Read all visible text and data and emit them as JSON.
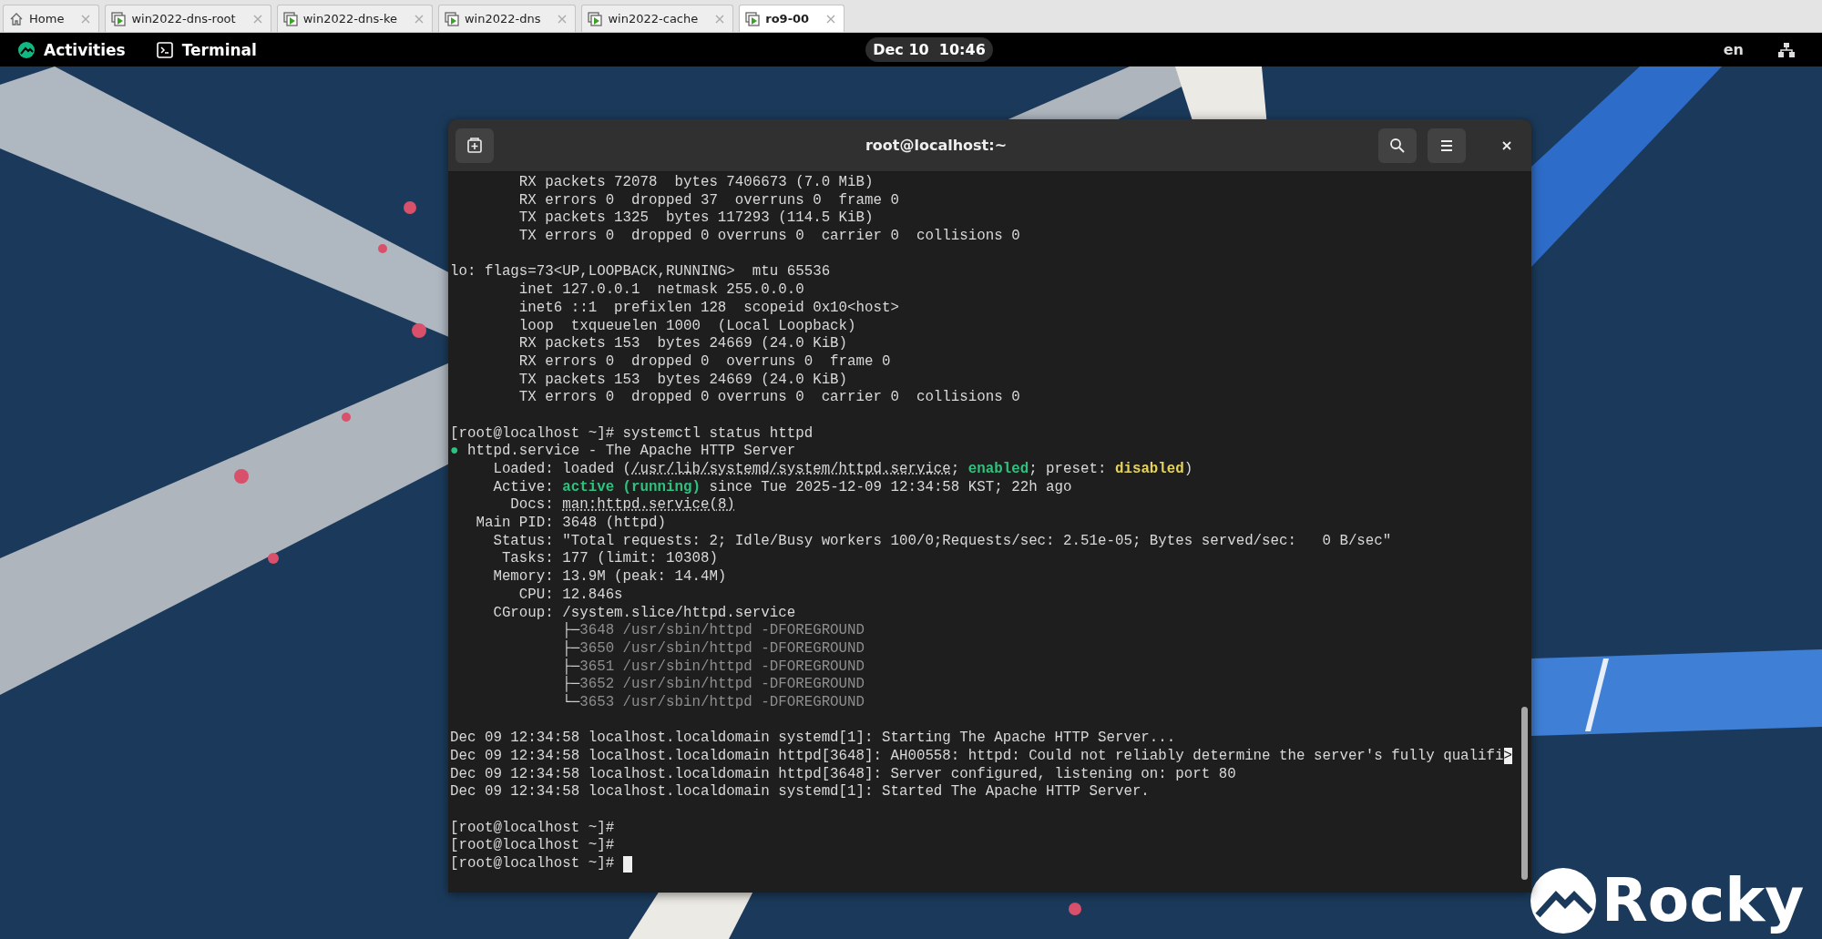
{
  "browser_tabs": [
    {
      "label": "Home",
      "kind": "home",
      "selected": false
    },
    {
      "label": "win2022-dns-root",
      "kind": "vm",
      "selected": false
    },
    {
      "label": "win2022-dns-ke",
      "kind": "vm",
      "selected": false
    },
    {
      "label": "win2022-dns",
      "kind": "vm",
      "selected": false
    },
    {
      "label": "win2022-cache",
      "kind": "vm",
      "selected": false
    },
    {
      "label": "ro9-00",
      "kind": "vm",
      "selected": true
    }
  ],
  "top_bar": {
    "activities": "Activities",
    "app": "Terminal",
    "clock": "Dec 10  10:46",
    "language": "en"
  },
  "terminal": {
    "title": "root@localhost:~",
    "lines": [
      {
        "text": "        RX packets 72078  bytes 7406673 (7.0 MiB)"
      },
      {
        "text": "        RX errors 0  dropped 37  overruns 0  frame 0"
      },
      {
        "text": "        TX packets 1325  bytes 117293 (114.5 KiB)"
      },
      {
        "text": "        TX errors 0  dropped 0 overruns 0  carrier 0  collisions 0"
      },
      {
        "kind": "blank"
      },
      {
        "text": "lo: flags=73<UP,LOOPBACK,RUNNING>  mtu 65536"
      },
      {
        "text": "        inet 127.0.0.1  netmask 255.0.0.0"
      },
      {
        "text": "        inet6 ::1  prefixlen 128  scopeid 0x10<host>"
      },
      {
        "text": "        loop  txqueuelen 1000  (Local Loopback)"
      },
      {
        "text": "        RX packets 153  bytes 24669 (24.0 KiB)"
      },
      {
        "text": "        RX errors 0  dropped 0  overruns 0  frame 0"
      },
      {
        "text": "        TX packets 153  bytes 24669 (24.0 KiB)"
      },
      {
        "text": "        TX errors 0  dropped 0 overruns 0  carrier 0  collisions 0"
      },
      {
        "kind": "blank"
      },
      {
        "text": "[root@localhost ~]# systemctl status httpd"
      },
      {
        "segments": [
          {
            "text": "●",
            "kind": "green"
          },
          {
            "text": " httpd.service - The Apache HTTP Server",
            "kind": "plain"
          }
        ]
      },
      {
        "segments": [
          {
            "text": "     Loaded: loaded (",
            "kind": "plain"
          },
          {
            "text": "/usr/lib/systemd/system/httpd.service",
            "kind": "link"
          },
          {
            "text": "; ",
            "kind": "plain"
          },
          {
            "text": "enabled",
            "kind": "green"
          },
          {
            "text": "; preset: ",
            "kind": "plain"
          },
          {
            "text": "disabled",
            "kind": "yellow"
          },
          {
            "text": ")",
            "kind": "plain"
          }
        ]
      },
      {
        "segments": [
          {
            "text": "     Active: ",
            "kind": "plain"
          },
          {
            "text": "active (running)",
            "kind": "green"
          },
          {
            "text": " since Tue 2025-12-09 12:34:58 KST; 22h ago",
            "kind": "plain"
          }
        ]
      },
      {
        "segments": [
          {
            "text": "       Docs: ",
            "kind": "plain"
          },
          {
            "text": "man:httpd.service(8)",
            "kind": "link"
          }
        ]
      },
      {
        "text": "   Main PID: 3648 (httpd)"
      },
      {
        "text": "     Status: \"Total requests: 2; Idle/Busy workers 100/0;Requests/sec: 2.51e-05; Bytes served/sec:   0 B/sec\""
      },
      {
        "text": "      Tasks: 177 (limit: 10308)"
      },
      {
        "text": "     Memory: 13.9M (peak: 14.4M)"
      },
      {
        "text": "        CPU: 12.846s"
      },
      {
        "text": "     CGroup: /system.slice/httpd.service"
      },
      {
        "segments": [
          {
            "text": "             ├─",
            "kind": "plain"
          },
          {
            "text": "3648 /usr/sbin/httpd -DFOREGROUND",
            "kind": "dim"
          }
        ]
      },
      {
        "segments": [
          {
            "text": "             ├─",
            "kind": "plain"
          },
          {
            "text": "3650 /usr/sbin/httpd -DFOREGROUND",
            "kind": "dim"
          }
        ]
      },
      {
        "segments": [
          {
            "text": "             ├─",
            "kind": "plain"
          },
          {
            "text": "3651 /usr/sbin/httpd -DFOREGROUND",
            "kind": "dim"
          }
        ]
      },
      {
        "segments": [
          {
            "text": "             ├─",
            "kind": "plain"
          },
          {
            "text": "3652 /usr/sbin/httpd -DFOREGROUND",
            "kind": "dim"
          }
        ]
      },
      {
        "segments": [
          {
            "text": "             └─",
            "kind": "plain"
          },
          {
            "text": "3653 /usr/sbin/httpd -DFOREGROUND",
            "kind": "dim"
          }
        ]
      },
      {
        "kind": "blank"
      },
      {
        "text": "Dec 09 12:34:58 localhost.localdomain systemd[1]: Starting The Apache HTTP Server..."
      },
      {
        "segments": [
          {
            "text": "Dec 09 12:34:58 localhost.localdomain httpd[3648]: AH00558: httpd: Could not reliably determine the server's fully qualifi",
            "kind": "plain"
          },
          {
            "text": ">",
            "kind": "marker"
          }
        ]
      },
      {
        "text": "Dec 09 12:34:58 localhost.localdomain httpd[3648]: Server configured, listening on: port 80"
      },
      {
        "text": "Dec 09 12:34:58 localhost.localdomain systemd[1]: Started The Apache HTTP Server."
      },
      {
        "kind": "blank"
      },
      {
        "text": "[root@localhost ~]#"
      },
      {
        "text": "[root@localhost ~]#"
      },
      {
        "text": "[root@localhost ~]#",
        "cursor": true
      }
    ]
  },
  "wallpaper": {
    "logo_text": "Rocky"
  }
}
